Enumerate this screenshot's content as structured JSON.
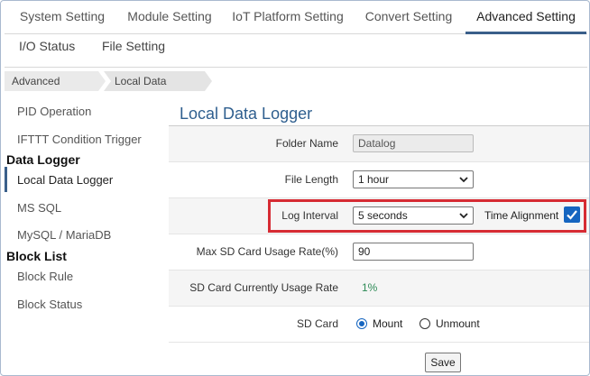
{
  "tabs": [
    {
      "label": "System Setting"
    },
    {
      "label": "Module Setting"
    },
    {
      "label": "IoT Platform Setting"
    },
    {
      "label": "Convert Setting"
    },
    {
      "label": "Advanced Setting",
      "active": true
    }
  ],
  "subtabs": [
    {
      "label": "I/O Status"
    },
    {
      "label": "File Setting"
    }
  ],
  "breadcrumb": [
    "Advanced Setting",
    "Local Data Logger"
  ],
  "sidebar": {
    "items_top": [
      "PID Operation",
      "IFTTT Condition Trigger"
    ],
    "group1": "Data Logger",
    "group1_items": [
      "Local Data Logger",
      "MS SQL",
      "MySQL / MariaDB"
    ],
    "group2": "Block List",
    "group2_items": [
      "Block Rule",
      "Block Status"
    ]
  },
  "main": {
    "title": "Local Data Logger",
    "folder_name": {
      "label": "Folder Name",
      "value": "Datalog"
    },
    "file_length": {
      "label": "File Length",
      "value": "1 hour"
    },
    "log_interval": {
      "label": "Log Interval",
      "value": "5 seconds",
      "time_alignment_label": "Time Alignment",
      "time_alignment_checked": true
    },
    "max_usage": {
      "label": "Max SD Card Usage Rate(%)",
      "value": "90"
    },
    "current_usage": {
      "label": "SD Card Currently Usage Rate",
      "value": "1%"
    },
    "sd_card": {
      "label": "SD Card",
      "options": [
        "Mount",
        "Unmount"
      ],
      "selected": "Mount"
    },
    "save_label": "Save"
  },
  "colors": {
    "accent": "#2f5f8f",
    "highlight": "#d62b33",
    "checkbox": "#1565c0",
    "usage_text": "#2e8b57"
  }
}
